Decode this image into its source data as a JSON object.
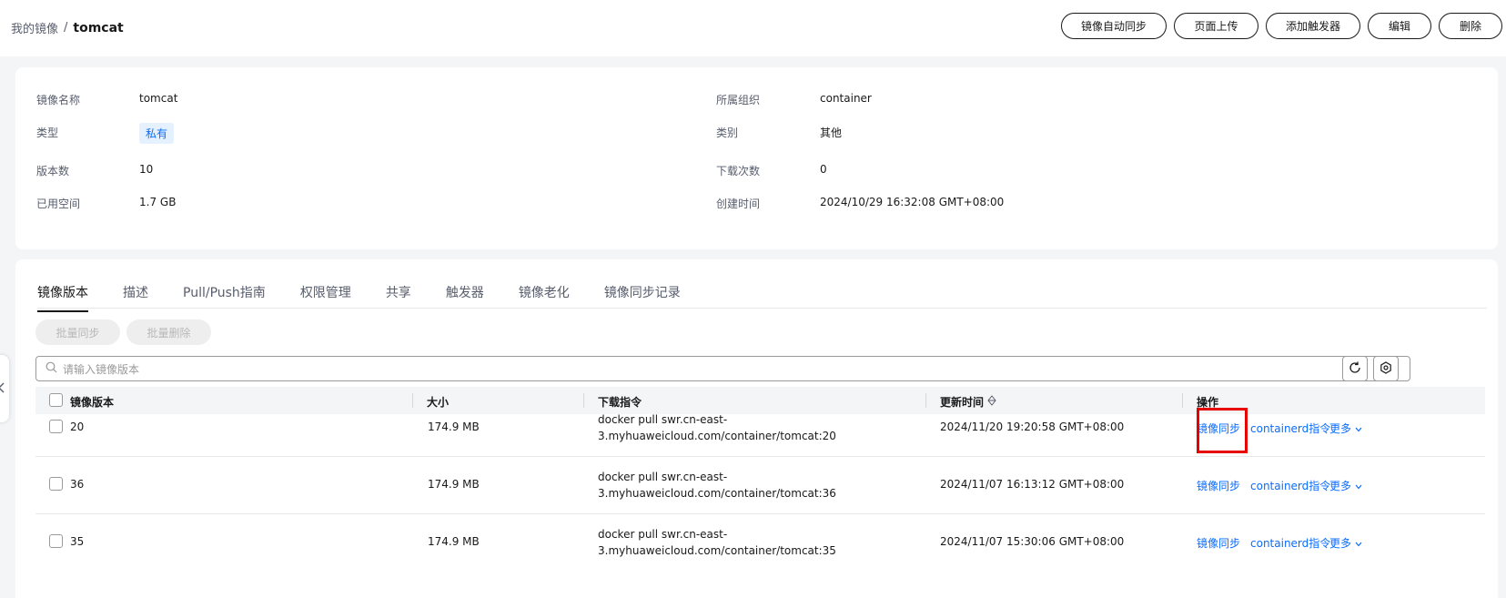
{
  "breadcrumb": {
    "parent": "我的镜像",
    "separator": "/",
    "current": "tomcat"
  },
  "header_actions": [
    "镜像自动同步",
    "页面上传",
    "添加触发器",
    "编辑",
    "删除"
  ],
  "info": {
    "name_label": "镜像名称",
    "name": "tomcat",
    "org_label": "所属组织",
    "org": "container",
    "type_label": "类型",
    "type": "私有",
    "category_label": "类别",
    "category": "其他",
    "versions_label": "版本数",
    "versions": "10",
    "downloads_label": "下载次数",
    "downloads": "0",
    "space_label": "已用空间",
    "space": "1.7 GB",
    "created_label": "创建时间",
    "created": "2024/10/29 16:32:08 GMT+08:00"
  },
  "tabs": [
    "镜像版本",
    "描述",
    "Pull/Push指南",
    "权限管理",
    "共享",
    "触发器",
    "镜像老化",
    "镜像同步记录"
  ],
  "bulk": {
    "sync": "批量同步",
    "delete": "批量删除"
  },
  "search": {
    "placeholder": "请输入镜像版本"
  },
  "table": {
    "headers": {
      "version": "镜像版本",
      "size": "大小",
      "command": "下载指令",
      "updated": "更新时间",
      "actions": "操作"
    },
    "rows": [
      {
        "version": "20",
        "size": "174.9 MB",
        "cmd1": "docker pull swr.cn-east-",
        "cmd2": "3.myhuaweicloud.com/container/tomcat:20",
        "updated": "2024/11/20 19:20:58 GMT+08:00",
        "sync": "镜像同步",
        "containerd": "containerd指令",
        "more": "更多"
      },
      {
        "version": "36",
        "size": "174.9 MB",
        "cmd1": "docker pull swr.cn-east-",
        "cmd2": "3.myhuaweicloud.com/container/tomcat:36",
        "updated": "2024/11/07 16:13:12 GMT+08:00",
        "sync": "镜像同步",
        "containerd": "containerd指令",
        "more": "更多"
      },
      {
        "version": "35",
        "size": "174.9 MB",
        "cmd1": "docker pull swr.cn-east-",
        "cmd2": "3.myhuaweicloud.com/container/tomcat:35",
        "updated": "2024/11/07 15:30:06 GMT+08:00",
        "sync": "镜像同步",
        "containerd": "containerd指令",
        "more": "更多"
      }
    ]
  },
  "colors": {
    "link": "#0a6cff",
    "highlight": "#e60000",
    "badge_bg": "#e5f1ff"
  },
  "icons": [
    "search-icon",
    "refresh-icon",
    "settings-icon",
    "sort-icon",
    "chevron-down-icon",
    "chevron-left-icon"
  ]
}
